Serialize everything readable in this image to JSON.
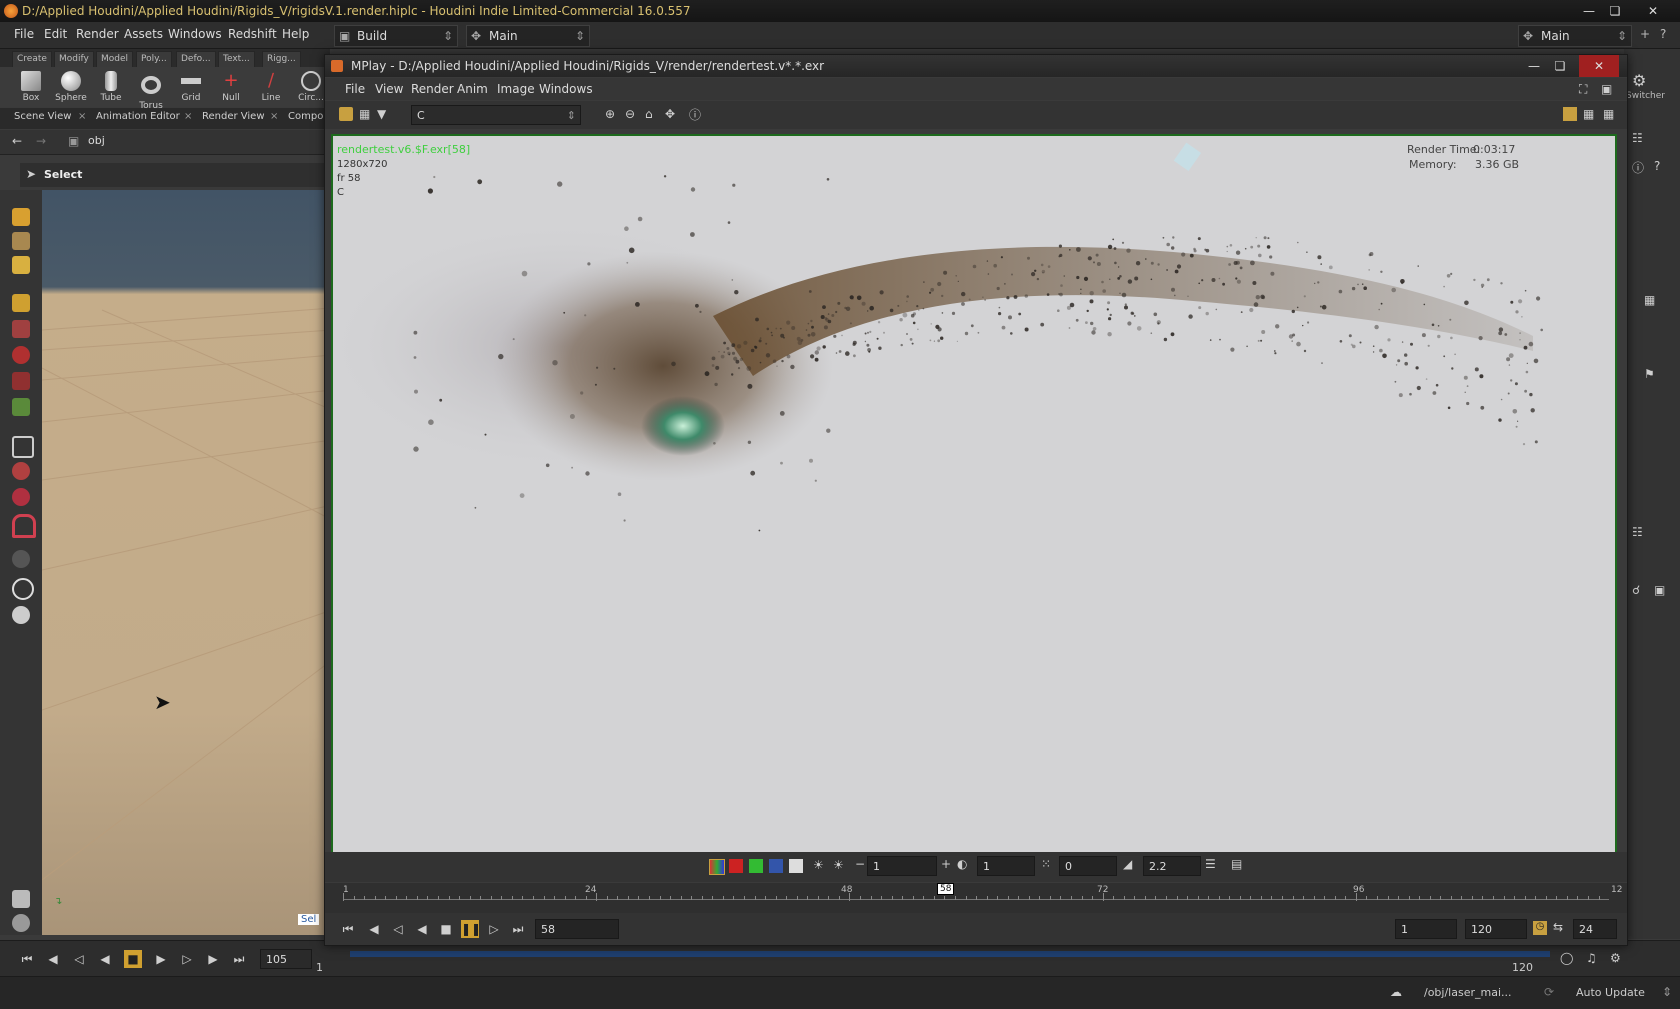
{
  "app": {
    "title": "D:/Applied Houdini/Applied Houdini/Rigids_V/rigidsV.1.render.hiplc - Houdini Indie Limited-Commercial 16.0.557",
    "menus": [
      "File",
      "Edit",
      "Render",
      "Assets",
      "Windows",
      "Redshift",
      "Help"
    ],
    "desktop": "Build",
    "main_label": "Main",
    "right_main": "Main",
    "switcher": "Switcher"
  },
  "shelf": {
    "tabs": [
      "Create",
      "Modify",
      "Model",
      "Poly...",
      "Defo...",
      "Text...",
      "Rigg..."
    ],
    "tools": [
      "Box",
      "Sphere",
      "Tube",
      "Torus",
      "Grid",
      "Null",
      "Line",
      "Circ..."
    ]
  },
  "panes": {
    "tabs": [
      "Scene View",
      "Animation Editor",
      "Render View",
      "Compo..."
    ],
    "path": "obj",
    "select_label": "Select",
    "sel_badge": "Sel"
  },
  "playbar": {
    "frame": "105",
    "start": "1",
    "end_field": "120",
    "auto_update": "Auto Update",
    "node_path": "/obj/laser_mai..."
  },
  "mplay": {
    "title": "MPlay - D:/Applied Houdini/Applied Houdini/Rigids_V/render/rendertest.v*.*.exr",
    "menus": [
      "File",
      "View",
      "Render",
      "Anim",
      "Image",
      "Windows"
    ],
    "plane": "C",
    "overlay": {
      "file": "rendertest.v6.$F.exr[58]",
      "res": "1280x720",
      "frame": "fr 58",
      "plane": "C",
      "render_time_label": "Render Time:",
      "render_time": "0:03:17",
      "memory_label": "Memory:",
      "memory": "3.36 GB"
    },
    "controls": {
      "exposure": "1",
      "brightness": "1",
      "offset": "0",
      "gamma": "2.2"
    },
    "timeline": {
      "ticks": [
        "1",
        "24",
        "48",
        "72",
        "96",
        "12"
      ],
      "current": "58"
    },
    "play": {
      "frame": "58",
      "start": "1",
      "end": "120",
      "fps": "24"
    }
  },
  "colors": {
    "image_border": "#1d6a1d",
    "overlay_text": "#3fcf3f",
    "title_text": "#d8c070"
  }
}
